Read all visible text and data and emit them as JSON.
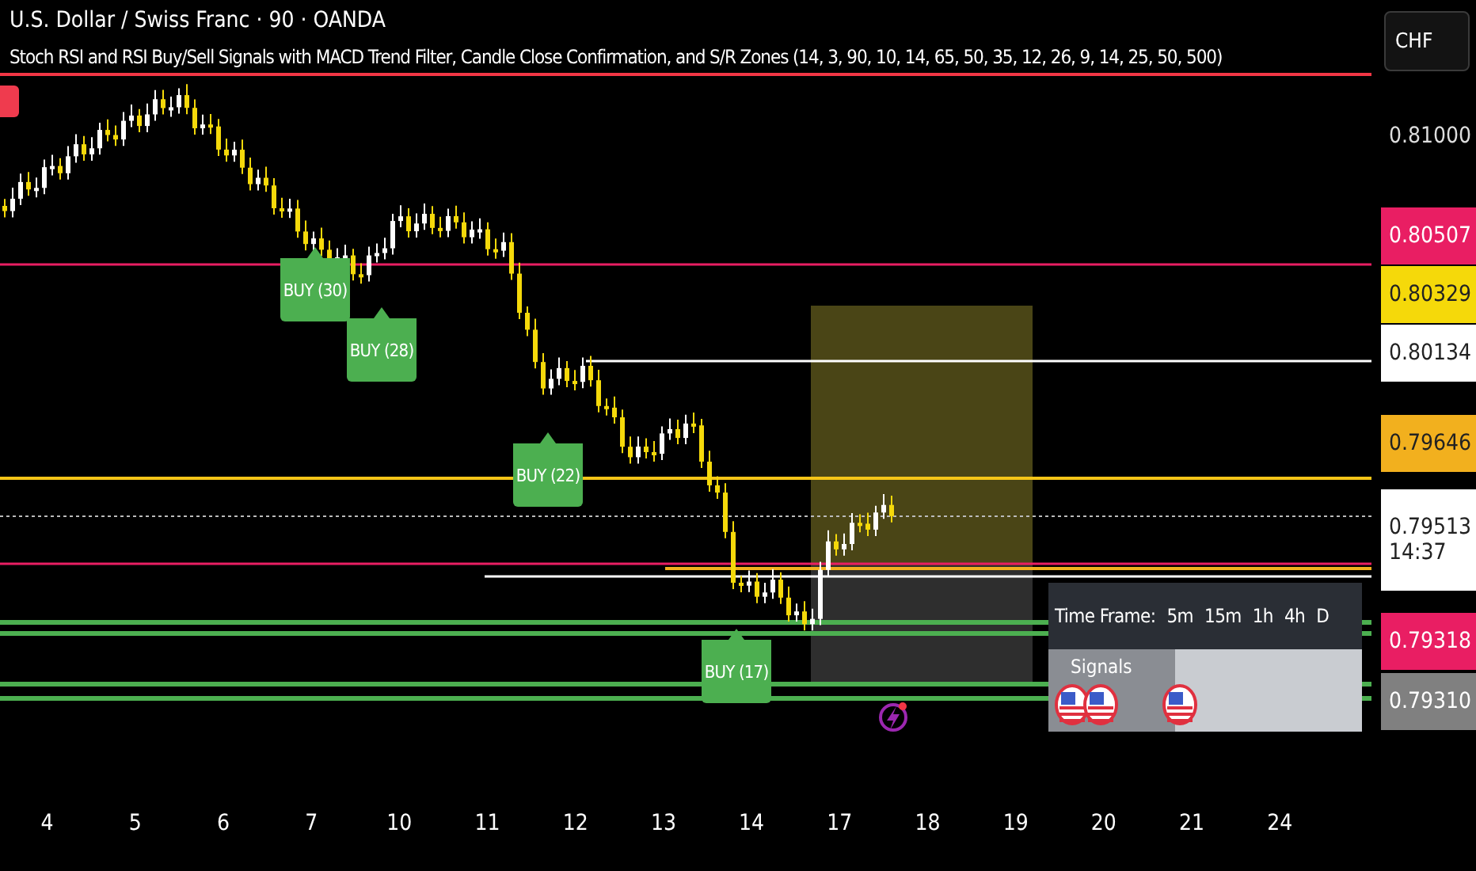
{
  "header": {
    "title": "U.S. Dollar / Swiss Franc · 90 · OANDA",
    "indicator": "Stoch RSI and RSI Buy/Sell Signals with MACD Trend Filter, Candle Close Confirmation, and S/R Zones (14, 3, 90, 10, 14, 65, 50, 35, 12, 26, 9, 14, 25, 50, 500)"
  },
  "currency_button": "CHF",
  "price_scale": [
    {
      "kind": "plain",
      "label": "0.81000"
    },
    {
      "kind": "tag",
      "label": "0.80507",
      "color": "#e91e63"
    },
    {
      "kind": "tag",
      "label": "0.80329",
      "color": "#f5d90a"
    },
    {
      "kind": "tag",
      "label": "0.80134",
      "color": "#ffffff"
    },
    {
      "kind": "tag",
      "label": "0.79646",
      "color": "#f2b01e"
    },
    {
      "kind": "tag",
      "label": "0.79513",
      "time": "14:37",
      "color": "#ffffff"
    },
    {
      "kind": "tag",
      "label": "0.79318",
      "color": "#e91e63"
    },
    {
      "kind": "tag",
      "label": "0.79310",
      "color": "#808080"
    }
  ],
  "signals": [
    {
      "kind": "buy",
      "label": "BUY (30)"
    },
    {
      "kind": "buy",
      "label": "BUY (28)"
    },
    {
      "kind": "buy",
      "label": "BUY (22)"
    },
    {
      "kind": "buy",
      "label": "BUY (17)"
    }
  ],
  "table": {
    "title": "Time Frame:",
    "timeframes": [
      "5m",
      "15m",
      "1h",
      "4h",
      "D"
    ],
    "signals_label": "Signals"
  },
  "time_axis": [
    "4",
    "5",
    "6",
    "7",
    "10",
    "11",
    "12",
    "13",
    "14",
    "17",
    "18",
    "19",
    "20",
    "21",
    "24"
  ]
}
